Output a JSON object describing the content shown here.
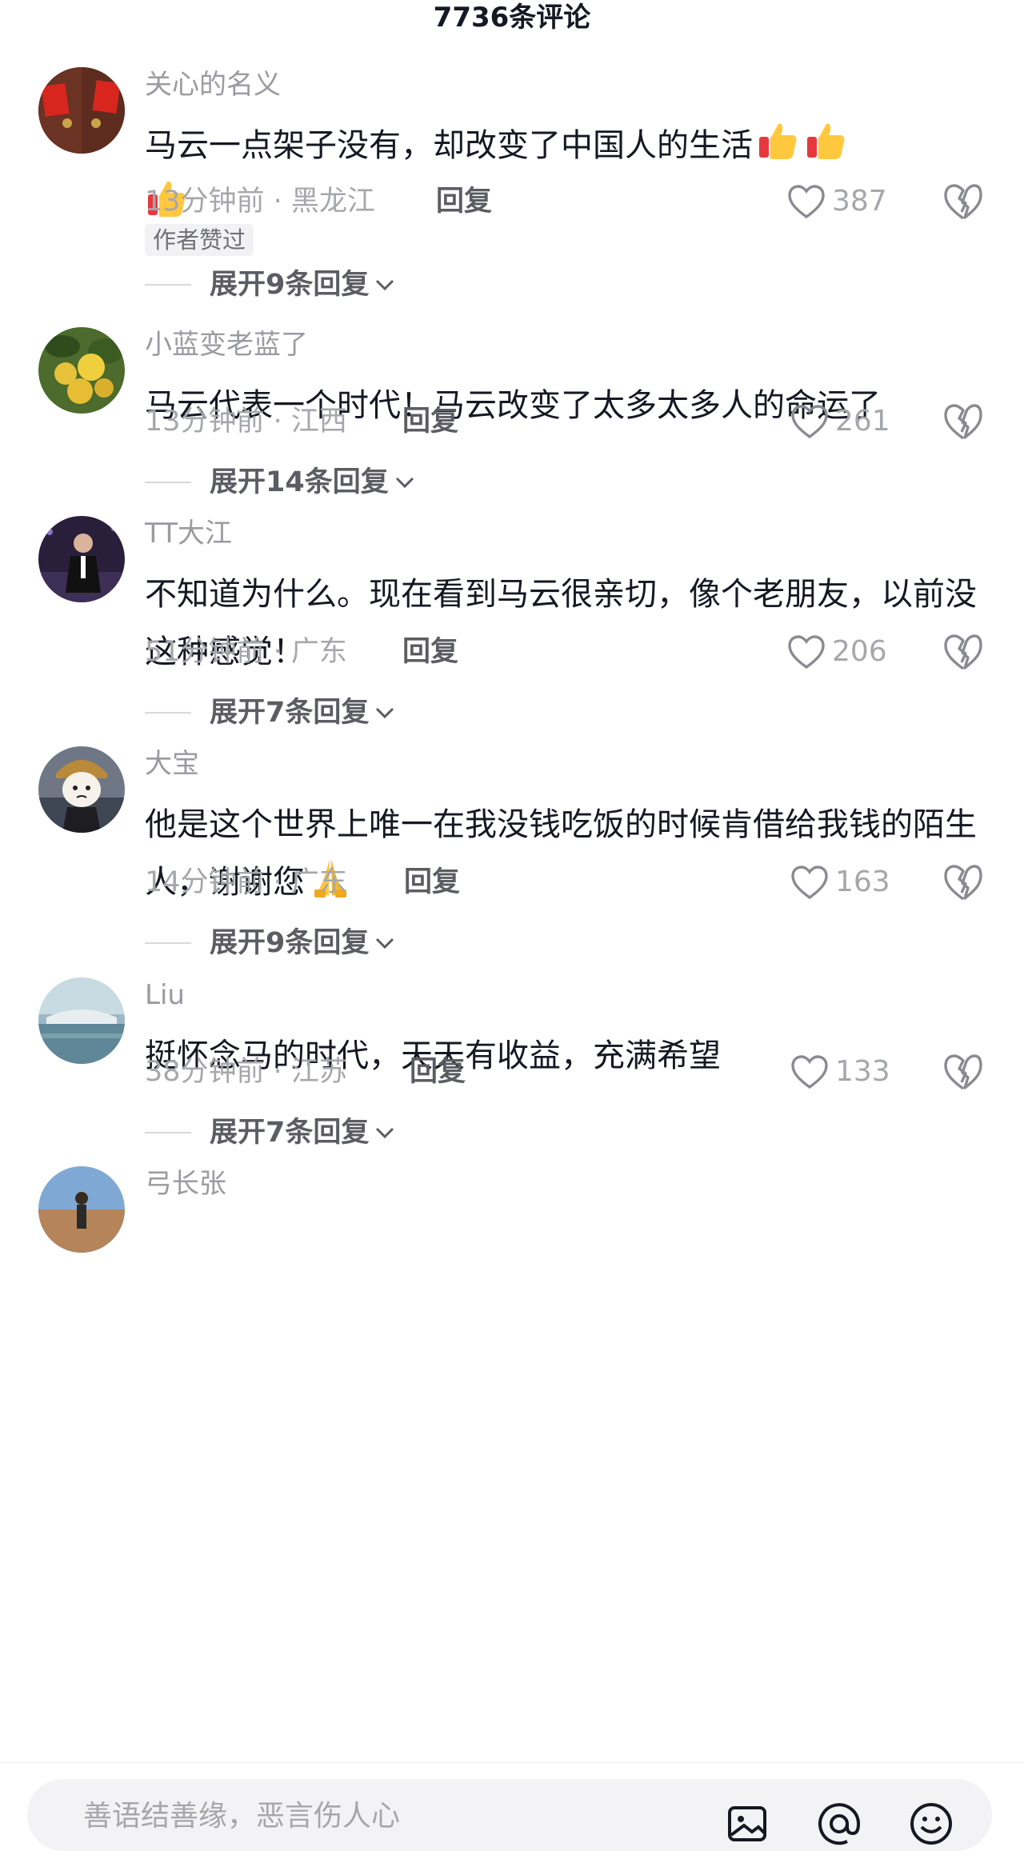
{
  "header": {
    "title": "7736条评论"
  },
  "comments": [
    {
      "username": "关心的名义",
      "text": "马云一点架子没有，却改变了中国人的生活",
      "emoji": [
        "thumbs-up",
        "thumbs-up",
        "thumbs-up"
      ],
      "time": "13分钟前 · 黑龙江",
      "reply_label": "回复",
      "likes": "387",
      "badge": "作者赞过",
      "expand_label": "展开9条回复"
    },
    {
      "username": "小蓝变老蓝了",
      "text": "马云代表一个时代！马云改变了太多太多人的命运了",
      "time": "13分钟前 · 江西",
      "reply_label": "回复",
      "likes": "261",
      "expand_label": "展开14条回复"
    },
    {
      "username": "TT大江",
      "text": "不知道为什么。现在看到马云很亲切，像个老朋友，以前没这种感觉！",
      "time": "51分钟前 · 广东",
      "reply_label": "回复",
      "likes": "206",
      "expand_label": "展开7条回复"
    },
    {
      "username": "大宝",
      "text": "他是这个世界上唯一在我没钱吃饭的时候肯借给我钱的陌生人，谢谢您",
      "emoji": [
        "folded-hands"
      ],
      "time": "14分钟前 · 广东",
      "reply_label": "回复",
      "likes": "163",
      "expand_label": "展开9条回复"
    },
    {
      "username": "Liu",
      "text": "挺怀念马的时代，天天有收益，充满希望",
      "time": "38分钟前 · 江苏",
      "reply_label": "回复",
      "likes": "133",
      "expand_label": "展开7条回复"
    },
    {
      "username": "弓长张"
    }
  ],
  "input": {
    "placeholder": "善语结善缘，恶言伤人心",
    "icons": [
      "image-icon",
      "at-icon",
      "emoji-icon"
    ]
  },
  "colors": {
    "text": "#161823",
    "secondary": "#a6a7ab",
    "username": "#9a9ba0",
    "emoji_yellow": "#ffc83d",
    "emoji_red": "#e8383d"
  }
}
